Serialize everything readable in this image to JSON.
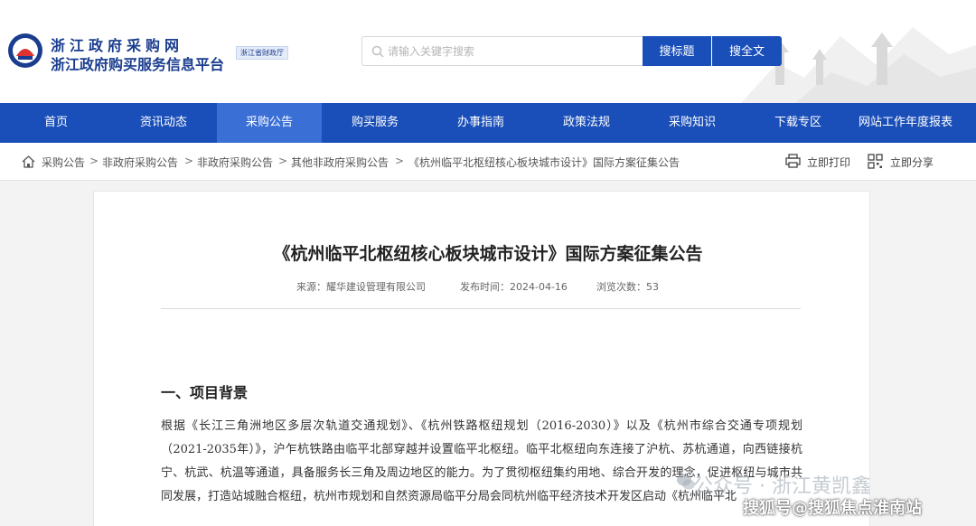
{
  "header": {
    "site_title": "浙江政府采购网",
    "site_subtitle": "浙江政府购买服务信息平台",
    "dept_badge": "浙江省财政厅",
    "search_placeholder": "请输入关键字搜索",
    "search_title_label": "搜标题",
    "search_full_label": "搜全文"
  },
  "nav": {
    "items": [
      "首页",
      "资讯动态",
      "采购公告",
      "购买服务",
      "办事指南",
      "政策法规",
      "采购知识",
      "下载专区",
      "网站工作年度报表"
    ],
    "active_index": 2
  },
  "breadcrumb": {
    "items": [
      "采购公告",
      "非政府采购公告",
      "非政府采购公告",
      "其他非政府采购公告",
      "《杭州临平北枢纽核心板块城市设计》国际方案征集公告"
    ],
    "separator": ">",
    "print_label": "立即打印",
    "share_label": "立即分享"
  },
  "article": {
    "title": "《杭州临平北枢纽核心板块城市设计》国际方案征集公告",
    "source": "来源：耀华建设管理有限公司",
    "publish_time": "发布时间：2024-04-16",
    "views": "浏览次数：53",
    "section_heading": "一、项目背景",
    "paragraph": "根据《长江三角洲地区多层次轨道交通规划》、《杭州铁路枢纽规划（2016-2030）》以及《杭州市综合交通专项规划（2021-2035年）》，沪乍杭铁路由临平北部穿越并设置临平北枢纽。临平北枢纽向东连接了沪杭、苏杭通道，向西链接杭宁、杭武、杭温等通道，具备服务长三角及周边地区的能力。为了贯彻枢纽集约用地、综合开发的理念，促进枢纽与城市共同发展，打造站城融合枢纽，杭州市规划和自然资源局临平分局会同杭州临平经济技术开发区启动《杭州临平北"
  },
  "watermark": {
    "account": "公众号 · 浙江黄凯鑫",
    "source": "搜狐号@搜狐焦点淮南站"
  },
  "colors": {
    "primary": "#1a4fb9",
    "nav_active": "#3a6fd6"
  }
}
